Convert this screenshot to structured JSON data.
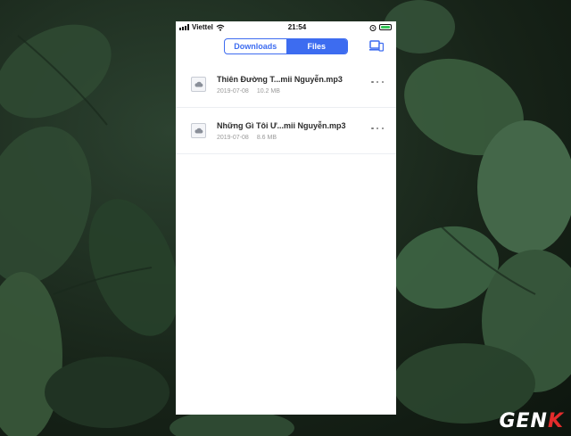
{
  "status_bar": {
    "carrier": "Viettel",
    "time": "21:54",
    "icons": [
      "signal-icon",
      "wifi-icon",
      "alarm-icon",
      "battery-icon"
    ]
  },
  "segmented_control": {
    "tabs": [
      {
        "label": "Downloads",
        "active": false
      },
      {
        "label": "Files",
        "active": true
      }
    ]
  },
  "files": [
    {
      "name": "Thiên Đường T...mii Nguyễn.mp3",
      "date": "2019-07-08",
      "size": "10.2 MB"
    },
    {
      "name": "Những Gì Tôi Ư...mii Nguyễn.mp3",
      "date": "2019-07-08",
      "size": "8.6 MB"
    }
  ],
  "watermark": {
    "text_main": "GEN",
    "text_accent": "K"
  },
  "colors": {
    "accent": "#3d6cf0",
    "battery": "#35c759",
    "watermark_accent": "#e32c2c"
  }
}
